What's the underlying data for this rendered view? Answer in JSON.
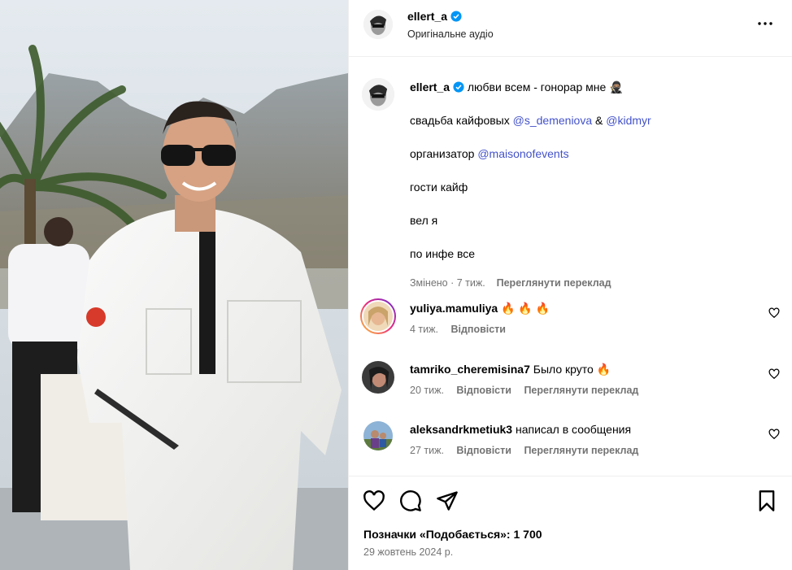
{
  "header": {
    "username": "ellert_a",
    "audio": "Оригінальне аудіо"
  },
  "caption": {
    "username": "ellert_a",
    "first_line": "любви всем - гонорар мне 🥷🏽",
    "lines": [
      {
        "text": "свадьба кайфовых ",
        "mention1": "@s_demeniova",
        "between": " & ",
        "mention2": "@kidmyr"
      },
      {
        "text": "организатор ",
        "mention": "@maisonofevents"
      },
      {
        "text": "гости кайф"
      },
      {
        "text": "вел я"
      },
      {
        "text": "по инфе все"
      }
    ],
    "edited": "Змінено · 7 тиж.",
    "translate": "Переглянути переклад"
  },
  "comments": [
    {
      "username": "yuliya.mamuliya",
      "text": "🔥 🔥 🔥",
      "time": "4 тиж.",
      "reply": "Відповісти",
      "translate": ""
    },
    {
      "username": "tamriko_cheremisina7",
      "text": "Было круто 🔥",
      "time": "20 тиж.",
      "reply": "Відповісти",
      "translate": "Переглянути переклад"
    },
    {
      "username": "aleksandrkmetiuk3",
      "text": "написал в сообщения",
      "time": "27 тиж.",
      "reply": "Відповісти",
      "translate": "Переглянути переклад"
    }
  ],
  "footer": {
    "likes": "Позначки «Подобається»: 1 700",
    "date": "29 жовтень 2024 р."
  },
  "icons": [
    "more-icon",
    "verified-icon",
    "heart-icon",
    "comment-icon",
    "share-icon",
    "bookmark-icon"
  ],
  "colors": {
    "mention": "#4352c9",
    "verified": "#0095f6",
    "muted": "#737373"
  }
}
